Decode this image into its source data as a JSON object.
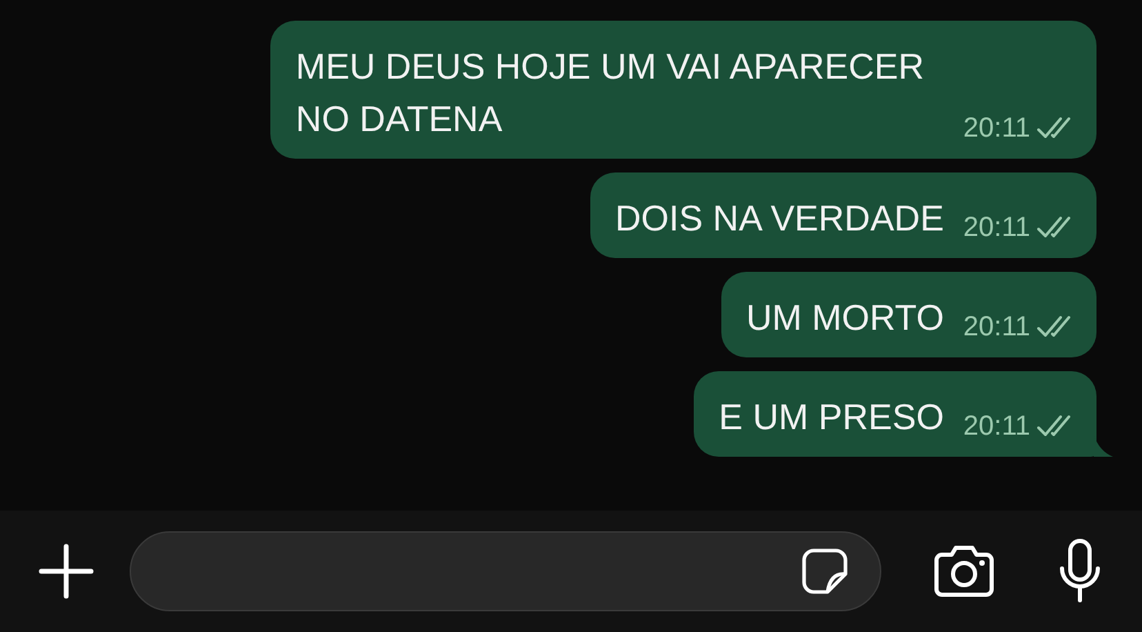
{
  "messages": [
    {
      "text": "MEU DEUS HOJE UM VAI APARECER NO DATENA",
      "time": "20:11",
      "read": false,
      "tail": false
    },
    {
      "text": "DOIS NA VERDADE",
      "time": "20:11",
      "read": false,
      "tail": false
    },
    {
      "text": "UM MORTO",
      "time": "20:11",
      "read": false,
      "tail": false
    },
    {
      "text": "E UM PRESO",
      "time": "20:11",
      "read": false,
      "tail": true
    }
  ]
}
